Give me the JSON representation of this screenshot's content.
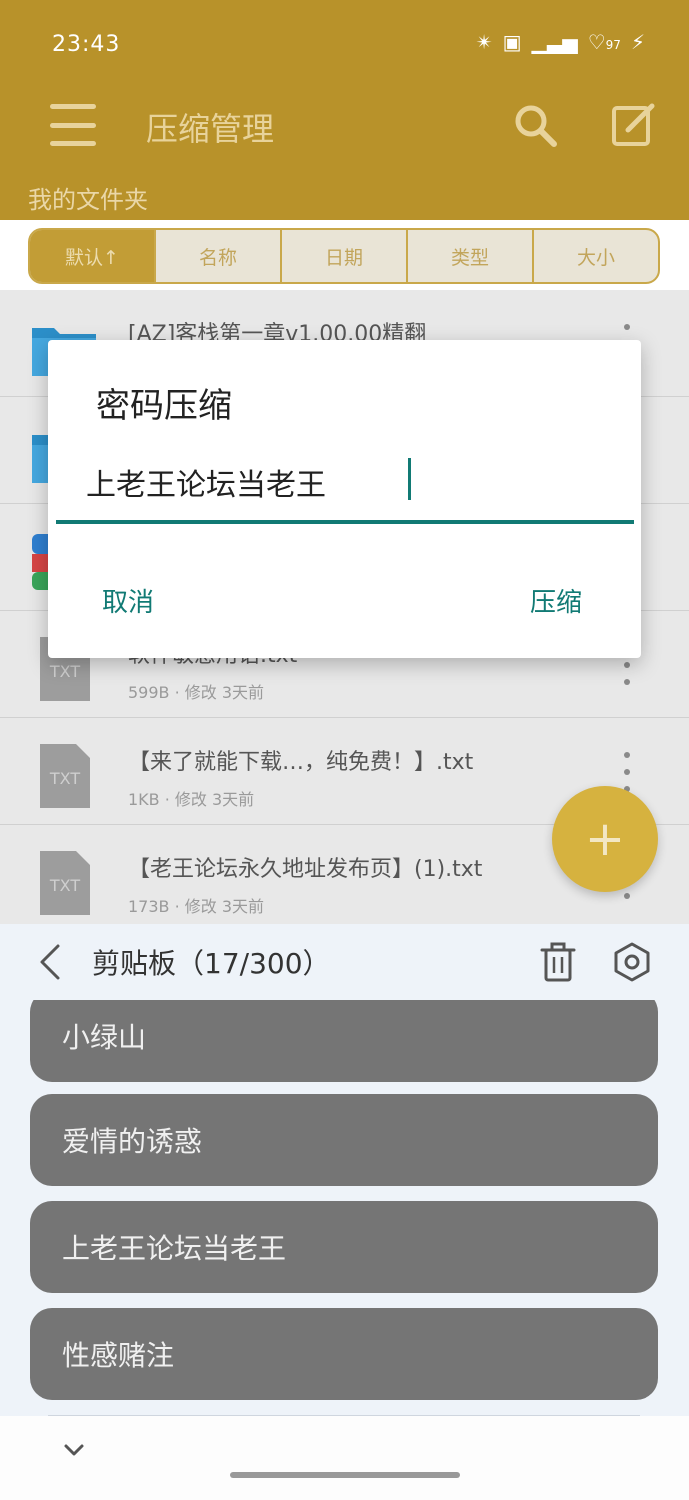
{
  "status_bar": {
    "time": "23:43",
    "icons": [
      "nfc-icon",
      "sim-icon",
      "signal-icon",
      "battery-icon",
      "charging-icon"
    ],
    "battery": "97"
  },
  "app_bar": {
    "title": "压缩管理",
    "folder": "我的文件夹",
    "icons": [
      "menu-icon",
      "search-icon",
      "edit-icon"
    ]
  },
  "sort_tabs": [
    "默认↑",
    "名称",
    "日期",
    "类型",
    "大小"
  ],
  "files": [
    {
      "name": "[AZ]客栈第一章v1.00.00精翻",
      "meta": "",
      "icon": "folder-icon"
    },
    {
      "name": "",
      "meta": "",
      "icon": "folder-icon"
    },
    {
      "name": "",
      "meta": "",
      "icon": "archive-icon"
    },
    {
      "name": "软件敏感用语.txt",
      "meta": "599B · 修改 3天前",
      "icon": "txt-file-icon"
    },
    {
      "name": "【来了就能下载…，纯免费！】.txt",
      "meta": "1KB · 修改 3天前",
      "icon": "txt-file-icon"
    },
    {
      "name": "【老王论坛永久地址发布页】(1).txt",
      "meta": "173B · 修改 3天前",
      "icon": "txt-file-icon"
    }
  ],
  "file_icon_label": "TXT",
  "fab_label": "+",
  "dialog": {
    "title": "密码压缩",
    "input_value": "上老王论坛当老王",
    "cancel_label": "取消",
    "confirm_label": "压缩"
  },
  "clipboard": {
    "title": "剪贴板（17/300）",
    "items": [
      "小绿山",
      "爱情的诱惑",
      "上老王论坛当老王",
      "性感赌注"
    ]
  },
  "colors": {
    "accent": "#b8922a",
    "dialog_accent": "#117a74",
    "clip_item": "#757575"
  }
}
